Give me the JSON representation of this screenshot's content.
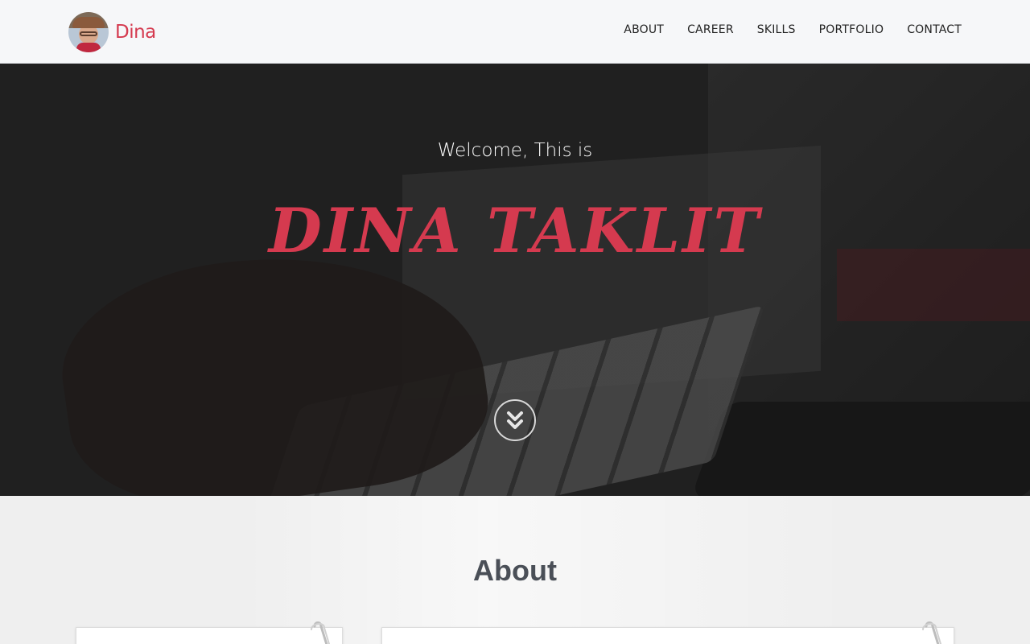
{
  "brand": {
    "name": "Dina",
    "logo": "avatar-photo"
  },
  "nav": {
    "items": [
      {
        "label": "ABOUT"
      },
      {
        "label": "CAREER"
      },
      {
        "label": "SKILLS"
      },
      {
        "label": "PORTFOLIO"
      },
      {
        "label": "CONTACT"
      }
    ]
  },
  "hero": {
    "welcome": "Welcome, This is",
    "title": "DINA TAKLIT",
    "scroll_icon": "chevrons-down-icon"
  },
  "about": {
    "title": "About"
  },
  "colors": {
    "accent": "#d53a4f",
    "nav_bg": "#f6f7f9",
    "heading": "#4a4f57"
  }
}
